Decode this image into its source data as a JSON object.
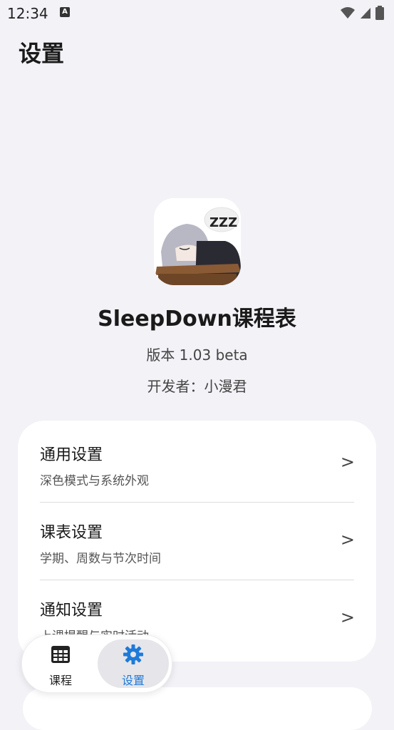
{
  "status_bar": {
    "time": "12:34",
    "notification_letter": "A"
  },
  "header": {
    "title": "设置"
  },
  "app_info": {
    "name": "SleepDown课程表",
    "version": "版本 1.03 beta",
    "developer": "开发者：小漫君",
    "icon_text": "ZZZ"
  },
  "settings": {
    "items": [
      {
        "title": "通用设置",
        "subtitle": "深色模式与系统外观",
        "arrow": ">"
      },
      {
        "title": "课表设置",
        "subtitle": "学期、周数与节次时间",
        "arrow": ">"
      },
      {
        "title": "通知设置",
        "subtitle": "上课提醒与实时活动",
        "arrow": ">"
      }
    ]
  },
  "bottom_nav": {
    "items": [
      {
        "label": "课程",
        "icon": "calendar-grid-icon",
        "active": false
      },
      {
        "label": "设置",
        "icon": "gear-icon",
        "active": true
      }
    ],
    "accent_color": "#1e7ad9"
  }
}
